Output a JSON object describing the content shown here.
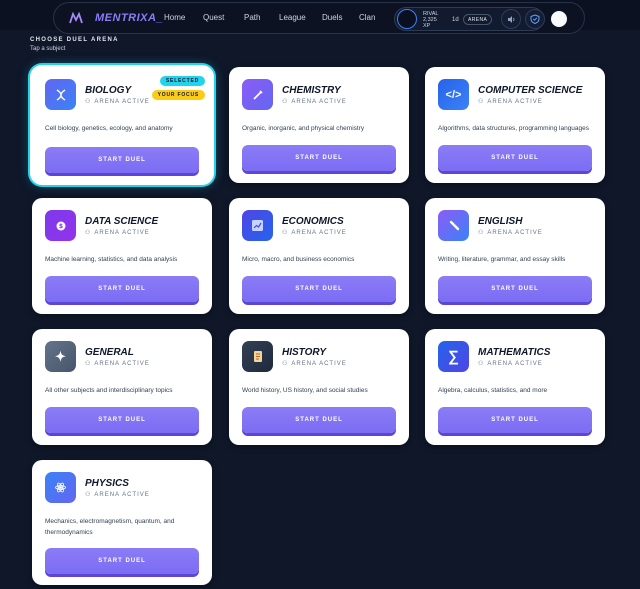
{
  "nav": {
    "logo": "MENTRIXA_",
    "links": [
      "Home",
      "Quest",
      "Path",
      "League",
      "Duels",
      "Clan"
    ],
    "rival_label": "RIVAL",
    "rival_xp": "2,325",
    "rival_xp_unit": "XP",
    "rival_gap": "1d",
    "arena_badge": "ARENA"
  },
  "page": {
    "heading": "CHOOSE DUEL ARENA",
    "subheading": "Tap a subject"
  },
  "cards": [
    {
      "name": "BIOLOGY",
      "status": "ARENA ACTIVE",
      "desc": "Cell biology, genetics, ecology, and anatomy",
      "button": "START DUEL",
      "icon": "dna-icon",
      "badge_selected": "SELECTED",
      "badge_focus": "YOUR FOCUS"
    },
    {
      "name": "CHEMISTRY",
      "status": "ARENA ACTIVE",
      "desc": "Organic, inorganic, and physical chemistry",
      "button": "START DUEL",
      "icon": "flask-icon"
    },
    {
      "name": "COMPUTER SCIENCE",
      "status": "ARENA ACTIVE",
      "desc": "Algorithms, data structures, programming languages",
      "button": "START DUEL",
      "icon": "code-icon"
    },
    {
      "name": "DATA SCIENCE",
      "status": "ARENA ACTIVE",
      "desc": "Machine learning, statistics, and data analysis",
      "button": "START DUEL",
      "icon": "data-icon"
    },
    {
      "name": "ECONOMICS",
      "status": "ARENA ACTIVE",
      "desc": "Micro, macro, and business economics",
      "button": "START DUEL",
      "icon": "chart-icon"
    },
    {
      "name": "ENGLISH",
      "status": "ARENA ACTIVE",
      "desc": "Writing, literature, grammar, and essay skills",
      "button": "START DUEL",
      "icon": "pen-icon"
    },
    {
      "name": "GENERAL",
      "status": "ARENA ACTIVE",
      "desc": "All other subjects and interdisciplinary topics",
      "button": "START DUEL",
      "icon": "sparkle-icon"
    },
    {
      "name": "HISTORY",
      "status": "ARENA ACTIVE",
      "desc": "World history, US history, and social studies",
      "button": "START DUEL",
      "icon": "scroll-icon"
    },
    {
      "name": "MATHEMATICS",
      "status": "ARENA ACTIVE",
      "desc": "Algebra, calculus, statistics, and more",
      "button": "START DUEL",
      "icon": "sigma-icon"
    },
    {
      "name": "PHYSICS",
      "status": "ARENA ACTIVE",
      "desc": "Mechanics, electromagnetism, quantum, and thermodynamics",
      "button": "START DUEL",
      "icon": "atom-icon"
    }
  ],
  "colors": {
    "background": "#0f1729",
    "accent": "#8b7cf6",
    "selected_ring": "#22d3ee",
    "focus_badge": "#facc15"
  }
}
